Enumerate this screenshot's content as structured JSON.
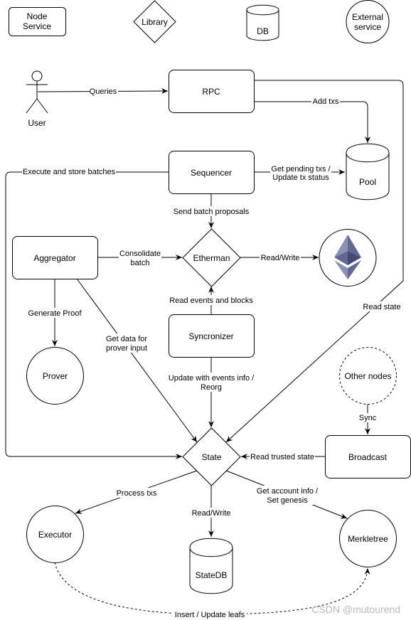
{
  "legend": {
    "node_service": "Node Service",
    "library": "Library",
    "db": "DB",
    "external_service": "External service"
  },
  "nodes": {
    "user": "User",
    "rpc": "RPC",
    "pool": "Pool",
    "sequencer": "Sequencer",
    "aggregator": "Aggregator",
    "etherman": "Etherman",
    "ethereum": "Ethereum",
    "prover": "Prover",
    "syncronizer": "Syncronizer",
    "other_nodes": "Other nodes",
    "state": "State",
    "broadcast": "Broadcast",
    "executor": "Executor",
    "statedb": "StateDB",
    "merkletree": "Merkletree"
  },
  "edges": {
    "queries": "Queries",
    "add_txs": "Add txs",
    "get_pending_txs": [
      "Get pending txs /",
      "Update tx status"
    ],
    "execute_store_batches": "Execute and store batches",
    "send_batch_proposals": "Send batch proposals",
    "consolidate_batch": [
      "Consolidate",
      "batch"
    ],
    "read_write_eth": "Read/Write",
    "read_events_blocks": "Read events and blocks",
    "read_state": "Read state",
    "generate_proof": "Generate Proof",
    "get_data_prover": [
      "Get data for",
      "prover input"
    ],
    "update_events": [
      "Update with events info /",
      "Reorg"
    ],
    "sync": "Sync",
    "read_trusted_state": "Read trusted state",
    "process_txs": "Process txs",
    "get_account_info": [
      "Get account info /",
      "Set genesis"
    ],
    "read_write_db": "Read/Write",
    "insert_update_leafs": "Insert / Update leafs"
  },
  "colors": {
    "eth_top_light": "#8a92b2",
    "eth_top_dark": "#62688f",
    "eth_mid": "#454a75",
    "eth_bottom": "#8a92b2",
    "other_nodes_stroke": "#555555"
  },
  "watermark": "CSDN @mutourend"
}
